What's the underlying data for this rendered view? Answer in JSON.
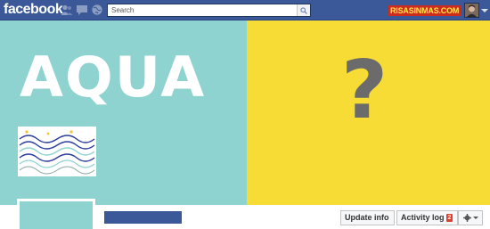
{
  "topbar": {
    "logo": "facebook",
    "jewels": [
      "friend-requests-icon",
      "messages-icon",
      "notifications-globe-icon"
    ],
    "search": {
      "placeholder": "Search"
    },
    "brand": "RISASINMAS.COM"
  },
  "cover": {
    "left_text": "AQUA",
    "right_text": "?",
    "left_color": "#8fd3d0",
    "right_color": "#f7dc35"
  },
  "profile": {
    "update_info_label": "Update info",
    "activity_log_label": "Activity log",
    "activity_badge": "2"
  },
  "colors": {
    "facebook_blue": "#3b5998",
    "badge_red": "#e03b2b"
  }
}
